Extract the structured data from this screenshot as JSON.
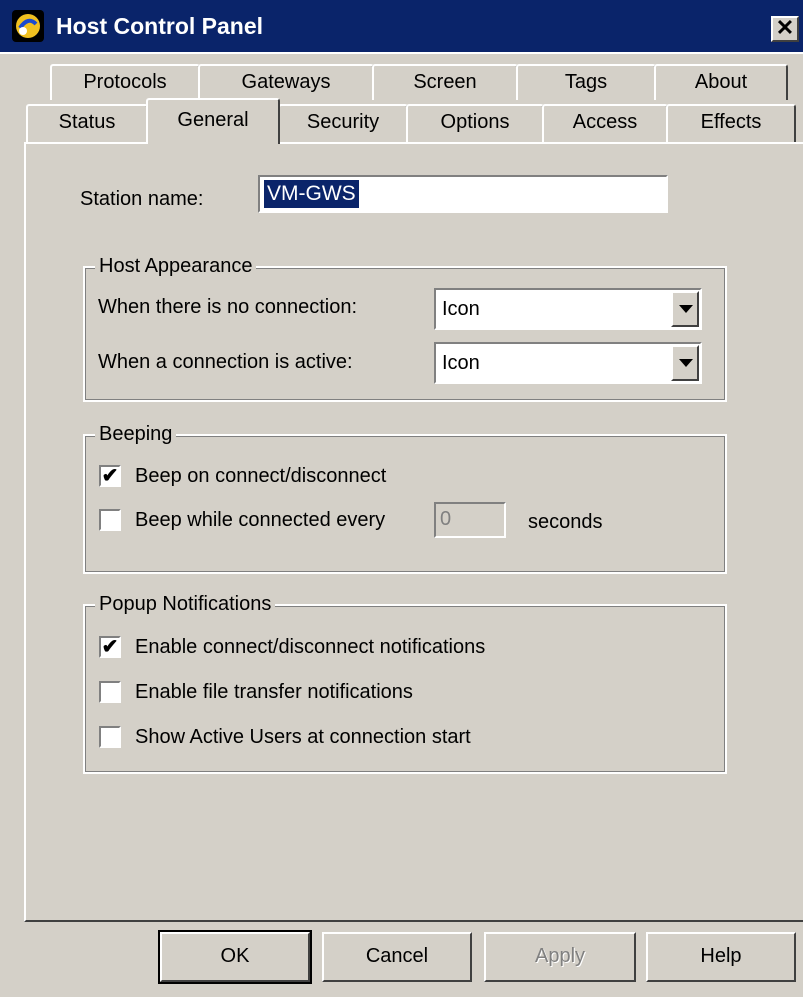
{
  "window": {
    "title": "Host Control Panel",
    "close_glyph": "✕"
  },
  "tabs": {
    "row1": [
      "Protocols",
      "Gateways",
      "Screen",
      "Tags",
      "About"
    ],
    "row2": [
      "Status",
      "General",
      "Security",
      "Options",
      "Access",
      "Effects"
    ],
    "active": "General"
  },
  "general": {
    "station_name_label": "Station name:",
    "station_name_value": "VM-GWS",
    "host_appearance": {
      "legend": "Host Appearance",
      "no_connection_label": "When there is no connection:",
      "no_connection_value": "Icon",
      "active_connection_label": "When a connection is active:",
      "active_connection_value": "Icon"
    },
    "beeping": {
      "legend": "Beeping",
      "beep_connect_label": "Beep on connect/disconnect",
      "beep_connect_checked": true,
      "beep_interval_label": "Beep while connected every",
      "beep_interval_checked": false,
      "beep_interval_value": "0",
      "seconds_label": "seconds"
    },
    "popup": {
      "legend": "Popup Notifications",
      "connect_notify_label": "Enable connect/disconnect notifications",
      "connect_notify_checked": true,
      "file_transfer_label": "Enable file transfer notifications",
      "file_transfer_checked": false,
      "active_users_label": "Show Active Users at connection start",
      "active_users_checked": false
    }
  },
  "buttons": {
    "ok": "OK",
    "cancel": "Cancel",
    "apply": "Apply",
    "help": "Help"
  },
  "colors": {
    "titlebar": "#0a246a",
    "face": "#d4d0c8",
    "selection": "#0a246a"
  }
}
